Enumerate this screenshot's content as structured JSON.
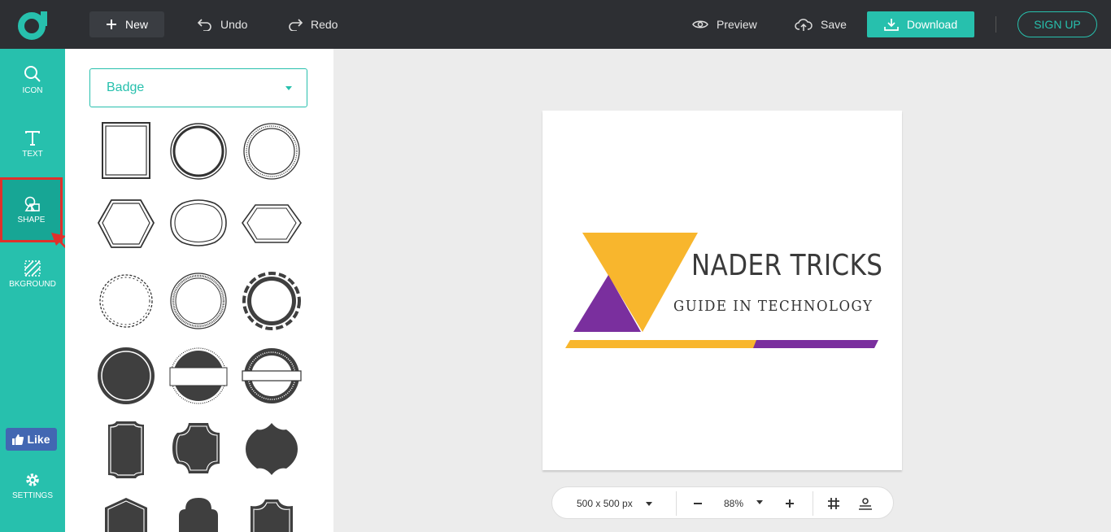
{
  "toolbar": {
    "new_label": "New",
    "undo_label": "Undo",
    "redo_label": "Redo",
    "preview_label": "Preview",
    "save_label": "Save",
    "download_label": "Download",
    "signup_label": "SIGN UP"
  },
  "sidebar": {
    "items": [
      {
        "label": "ICON",
        "icon": "search-icon"
      },
      {
        "label": "TEXT",
        "icon": "text-icon"
      },
      {
        "label": "SHAPE",
        "icon": "shape-icon"
      },
      {
        "label": "BKGROUND",
        "icon": "background-icon"
      },
      {
        "label": "SETTINGS",
        "icon": "gear-icon"
      }
    ],
    "like_label": "Like"
  },
  "panel": {
    "category_selected": "Badge"
  },
  "design": {
    "brand_text": "NADER TRICKS",
    "tagline_text": "GUIDE IN TECHNOLOGY"
  },
  "zoombar": {
    "size_label": "500 x 500 px",
    "zoom_label": "88%"
  },
  "colors": {
    "accent": "#27c0ad",
    "topbar": "#2d2f33",
    "logo_yellow": "#f8b62d",
    "logo_purple": "#7a2f9e",
    "highlight": "#e0302b"
  }
}
